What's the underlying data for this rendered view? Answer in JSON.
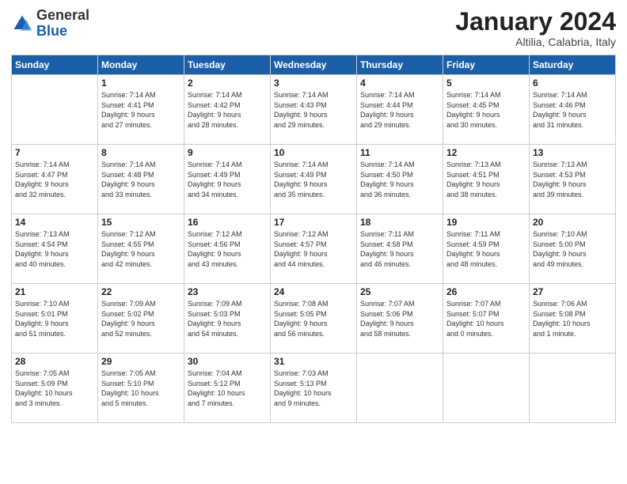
{
  "header": {
    "logo_general": "General",
    "logo_blue": "Blue",
    "month": "January 2024",
    "location": "Altilia, Calabria, Italy"
  },
  "weekdays": [
    "Sunday",
    "Monday",
    "Tuesday",
    "Wednesday",
    "Thursday",
    "Friday",
    "Saturday"
  ],
  "weeks": [
    [
      {
        "day": "",
        "info": ""
      },
      {
        "day": "1",
        "info": "Sunrise: 7:14 AM\nSunset: 4:41 PM\nDaylight: 9 hours\nand 27 minutes."
      },
      {
        "day": "2",
        "info": "Sunrise: 7:14 AM\nSunset: 4:42 PM\nDaylight: 9 hours\nand 28 minutes."
      },
      {
        "day": "3",
        "info": "Sunrise: 7:14 AM\nSunset: 4:43 PM\nDaylight: 9 hours\nand 29 minutes."
      },
      {
        "day": "4",
        "info": "Sunrise: 7:14 AM\nSunset: 4:44 PM\nDaylight: 9 hours\nand 29 minutes."
      },
      {
        "day": "5",
        "info": "Sunrise: 7:14 AM\nSunset: 4:45 PM\nDaylight: 9 hours\nand 30 minutes."
      },
      {
        "day": "6",
        "info": "Sunrise: 7:14 AM\nSunset: 4:46 PM\nDaylight: 9 hours\nand 31 minutes."
      }
    ],
    [
      {
        "day": "7",
        "info": "Sunrise: 7:14 AM\nSunset: 4:47 PM\nDaylight: 9 hours\nand 32 minutes."
      },
      {
        "day": "8",
        "info": "Sunrise: 7:14 AM\nSunset: 4:48 PM\nDaylight: 9 hours\nand 33 minutes."
      },
      {
        "day": "9",
        "info": "Sunrise: 7:14 AM\nSunset: 4:49 PM\nDaylight: 9 hours\nand 34 minutes."
      },
      {
        "day": "10",
        "info": "Sunrise: 7:14 AM\nSunset: 4:49 PM\nDaylight: 9 hours\nand 35 minutes."
      },
      {
        "day": "11",
        "info": "Sunrise: 7:14 AM\nSunset: 4:50 PM\nDaylight: 9 hours\nand 36 minutes."
      },
      {
        "day": "12",
        "info": "Sunrise: 7:13 AM\nSunset: 4:51 PM\nDaylight: 9 hours\nand 38 minutes."
      },
      {
        "day": "13",
        "info": "Sunrise: 7:13 AM\nSunset: 4:53 PM\nDaylight: 9 hours\nand 39 minutes."
      }
    ],
    [
      {
        "day": "14",
        "info": "Sunrise: 7:13 AM\nSunset: 4:54 PM\nDaylight: 9 hours\nand 40 minutes."
      },
      {
        "day": "15",
        "info": "Sunrise: 7:12 AM\nSunset: 4:55 PM\nDaylight: 9 hours\nand 42 minutes."
      },
      {
        "day": "16",
        "info": "Sunrise: 7:12 AM\nSunset: 4:56 PM\nDaylight: 9 hours\nand 43 minutes."
      },
      {
        "day": "17",
        "info": "Sunrise: 7:12 AM\nSunset: 4:57 PM\nDaylight: 9 hours\nand 44 minutes."
      },
      {
        "day": "18",
        "info": "Sunrise: 7:11 AM\nSunset: 4:58 PM\nDaylight: 9 hours\nand 46 minutes."
      },
      {
        "day": "19",
        "info": "Sunrise: 7:11 AM\nSunset: 4:59 PM\nDaylight: 9 hours\nand 48 minutes."
      },
      {
        "day": "20",
        "info": "Sunrise: 7:10 AM\nSunset: 5:00 PM\nDaylight: 9 hours\nand 49 minutes."
      }
    ],
    [
      {
        "day": "21",
        "info": "Sunrise: 7:10 AM\nSunset: 5:01 PM\nDaylight: 9 hours\nand 51 minutes."
      },
      {
        "day": "22",
        "info": "Sunrise: 7:09 AM\nSunset: 5:02 PM\nDaylight: 9 hours\nand 52 minutes."
      },
      {
        "day": "23",
        "info": "Sunrise: 7:09 AM\nSunset: 5:03 PM\nDaylight: 9 hours\nand 54 minutes."
      },
      {
        "day": "24",
        "info": "Sunrise: 7:08 AM\nSunset: 5:05 PM\nDaylight: 9 hours\nand 56 minutes."
      },
      {
        "day": "25",
        "info": "Sunrise: 7:07 AM\nSunset: 5:06 PM\nDaylight: 9 hours\nand 58 minutes."
      },
      {
        "day": "26",
        "info": "Sunrise: 7:07 AM\nSunset: 5:07 PM\nDaylight: 10 hours\nand 0 minutes."
      },
      {
        "day": "27",
        "info": "Sunrise: 7:06 AM\nSunset: 5:08 PM\nDaylight: 10 hours\nand 1 minute."
      }
    ],
    [
      {
        "day": "28",
        "info": "Sunrise: 7:05 AM\nSunset: 5:09 PM\nDaylight: 10 hours\nand 3 minutes."
      },
      {
        "day": "29",
        "info": "Sunrise: 7:05 AM\nSunset: 5:10 PM\nDaylight: 10 hours\nand 5 minutes."
      },
      {
        "day": "30",
        "info": "Sunrise: 7:04 AM\nSunset: 5:12 PM\nDaylight: 10 hours\nand 7 minutes."
      },
      {
        "day": "31",
        "info": "Sunrise: 7:03 AM\nSunset: 5:13 PM\nDaylight: 10 hours\nand 9 minutes."
      },
      {
        "day": "",
        "info": ""
      },
      {
        "day": "",
        "info": ""
      },
      {
        "day": "",
        "info": ""
      }
    ]
  ]
}
